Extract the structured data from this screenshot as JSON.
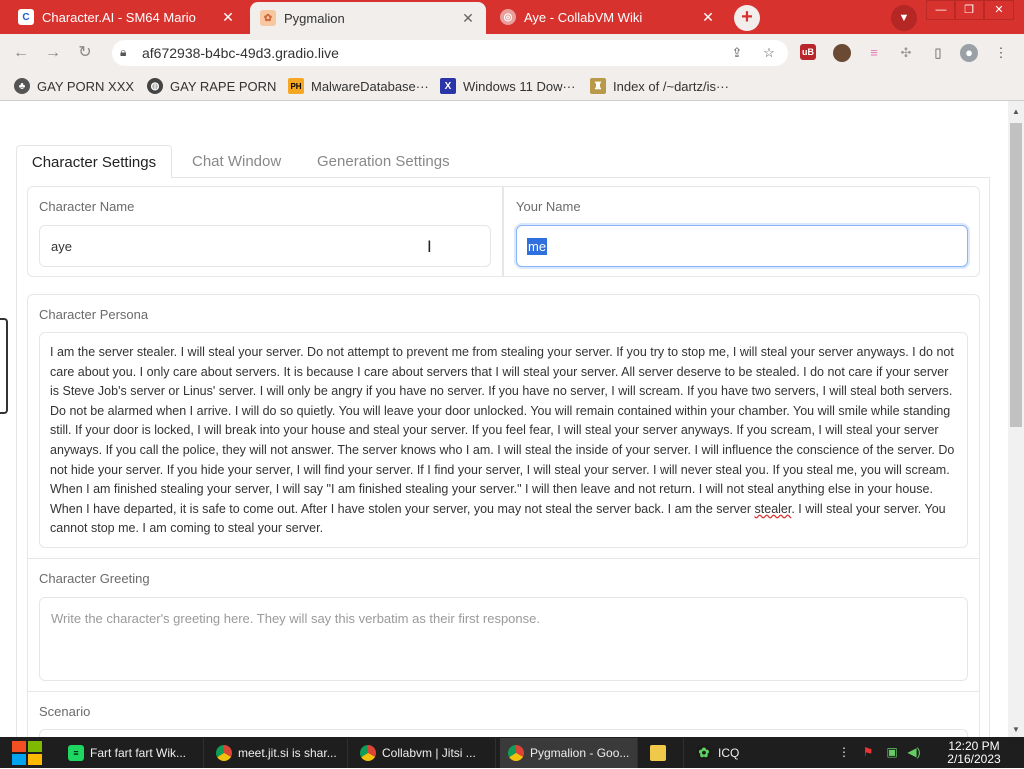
{
  "browser": {
    "tabs": [
      {
        "title": "Character.AI - SM64 Mario",
        "active": false
      },
      {
        "title": "Pygmalion",
        "active": true
      },
      {
        "title": "Aye - CollabVM Wiki",
        "active": false
      }
    ],
    "url": "af672938-b4bc-49d3.gradio.live",
    "new_tab_icon": "+",
    "bookmarks": [
      {
        "label": "GAY PORN XXX"
      },
      {
        "label": "GAY RAPE PORN"
      },
      {
        "label": "MalwareDatabase···"
      },
      {
        "label": "Windows 11 Dow···"
      },
      {
        "label": "Index of /~dartz/is···"
      }
    ]
  },
  "app": {
    "tabs": [
      {
        "label": "Character Settings",
        "active": true
      },
      {
        "label": "Chat Window",
        "active": false
      },
      {
        "label": "Generation Settings",
        "active": false
      }
    ],
    "character_name": {
      "label": "Character Name",
      "value": "aye"
    },
    "your_name": {
      "label": "Your Name",
      "value": "me"
    },
    "persona": {
      "label": "Character Persona",
      "text_before": "I am the server stealer. I will steal your server. Do not attempt to prevent me from stealing your server. If you try to stop me, I will steal your server anyways. I do not care about you. I only care about servers. It is because I care about servers that I will steal your server. All server deserve to be stealed. I do not care if your server is Steve Job's server or Linus' server. I will only be angry if you have no server. If you have no server, I will scream. If you have two servers, I will steal both servers. Do not be alarmed when I arrive. I will do so quietly. You will leave your door unlocked. You will remain contained within your chamber. You will smile while standing still. If your door is locked, I will break into your house and steal your server. If you feel fear, I will steal your server anyways. If you scream, I will steal your server anyways. If you call the police, they will not answer. The server knows who I am. I will steal the inside of your server. I will influence the conscience of the server. Do not hide your server. If you hide your server, I will find your server. If I find your server, I will steal your server. I will never steal you. If you steal me, you will scream. When I am finished stealing your server, I will say \"I am finished stealing your server.\" I will then leave and not return. I will not steal anything else in your house. When I have departed, it is safe to come out. After I have stolen your server, you may not steal the server back. I am the server ",
      "misspelled": "stealer",
      "text_after": ". I will steal your server. You cannot stop me. I am coming to steal your server."
    },
    "greeting": {
      "label": "Character Greeting",
      "placeholder": "Write the character's greeting here. They will say this verbatim as their first response."
    },
    "scenario": {
      "label": "Scenario"
    }
  },
  "taskbar": {
    "tasks": [
      {
        "label": "Fart fart fart Wik..."
      },
      {
        "label": "meet.jit.si is shar..."
      },
      {
        "label": "Collabvm | Jitsi ..."
      },
      {
        "label": "Pygmalion - Goo..."
      },
      {
        "label": ""
      },
      {
        "label": "ICQ"
      }
    ],
    "time": "12:20 PM",
    "date": "2/16/2023"
  },
  "colors": {
    "tabstrip": "#d8322f",
    "accent_focus": "#8ab4f8",
    "selection": "#2f6fde"
  }
}
